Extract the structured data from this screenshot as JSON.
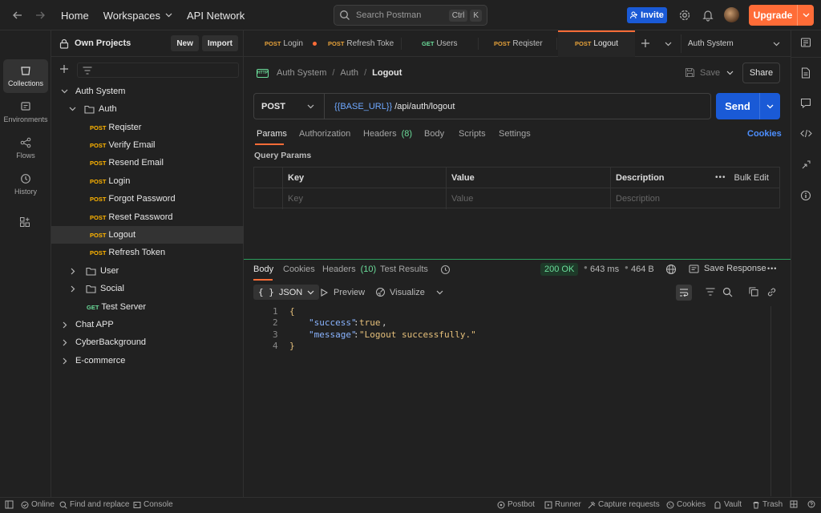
{
  "topbar": {
    "nav": [
      "Home",
      "Workspaces",
      "API Network"
    ],
    "search_placeholder": "Search Postman",
    "search_shortcut": [
      "Ctrl",
      "K"
    ],
    "invite_label": "Invite",
    "upgrade_label": "Upgrade"
  },
  "rail": {
    "items": [
      {
        "label": "Collections",
        "icon": "collections-icon"
      },
      {
        "label": "Environments",
        "icon": "environments-icon"
      },
      {
        "label": "Flows",
        "icon": "flows-icon"
      },
      {
        "label": "History",
        "icon": "history-icon"
      }
    ]
  },
  "sidebar": {
    "workspace_name": "Own Projects",
    "new_label": "New",
    "import_label": "Import",
    "tree": [
      {
        "label": "Auth System"
      },
      {
        "label": "Auth"
      },
      {
        "method": "POST",
        "label": "Reqister"
      },
      {
        "method": "POST",
        "label": "Verify Email"
      },
      {
        "method": "POST",
        "label": "Resend Email"
      },
      {
        "method": "POST",
        "label": "Login"
      },
      {
        "method": "POST",
        "label": "Forgot Password"
      },
      {
        "method": "POST",
        "label": "Reset Password"
      },
      {
        "method": "POST",
        "label": "Logout"
      },
      {
        "method": "POST",
        "label": "Refresh Token"
      },
      {
        "label": "User"
      },
      {
        "label": "Social"
      },
      {
        "method": "GET",
        "label": "Test Server"
      },
      {
        "label": "Chat APP"
      },
      {
        "label": "CyberBackground"
      },
      {
        "label": "E-commerce"
      }
    ]
  },
  "tabs": {
    "items": [
      {
        "method": "POST",
        "label": "Login"
      },
      {
        "method": "POST",
        "label": "Refresh Toke"
      },
      {
        "method": "GET",
        "label": "Users"
      },
      {
        "method": "POST",
        "label": "Reqister"
      },
      {
        "method": "POST",
        "label": "Logout"
      }
    ],
    "environment": "Auth System"
  },
  "request": {
    "breadcrumb": [
      "Auth System",
      "Auth",
      "Logout"
    ],
    "save_label": "Save",
    "share_label": "Share",
    "method": "POST",
    "url_var": "{{BASE_URL}}",
    "url_path": " /api/auth/logout",
    "send_label": "Send",
    "subtabs": [
      "Params",
      "Authorization",
      "Headers",
      "Body",
      "Scripts",
      "Settings"
    ],
    "headers_count": "(8)",
    "cookies_label": "Cookies",
    "query_params_title": "Query Params",
    "columns": [
      "Key",
      "Value",
      "Description"
    ],
    "bulk_edit_label": "Bulk Edit",
    "placeholders": [
      "Key",
      "Value",
      "Description"
    ]
  },
  "response": {
    "tabs": [
      "Body",
      "Cookies",
      "Headers",
      "Test Results"
    ],
    "headers_count": "(10)",
    "status": "200 OK",
    "time": "643 ms",
    "size": "464 B",
    "save_response_label": "Save Response",
    "format": "JSON",
    "preview_label": "Preview",
    "visualize_label": "Visualize",
    "line_numbers": [
      "1",
      "2",
      "3",
      "4"
    ],
    "code": {
      "open": "{",
      "key1": "\"success\"",
      "val1": "true",
      "key2": "\"message\"",
      "val2": "\"Logout successfully.\"",
      "close": "}"
    }
  },
  "status_bar": {
    "online": "Online",
    "find_replace": "Find and replace",
    "console": "Console",
    "postbot": "Postbot",
    "runner": "Runner",
    "capture": "Capture requests",
    "cookies": "Cookies",
    "vault": "Vault",
    "trash": "Trash"
  },
  "colors": {
    "accent": "#ff6c37",
    "primary": "#1a5ad6",
    "post": "#ffb400",
    "get": "#6bdd9a",
    "status_ok": "#2a9d5c"
  }
}
